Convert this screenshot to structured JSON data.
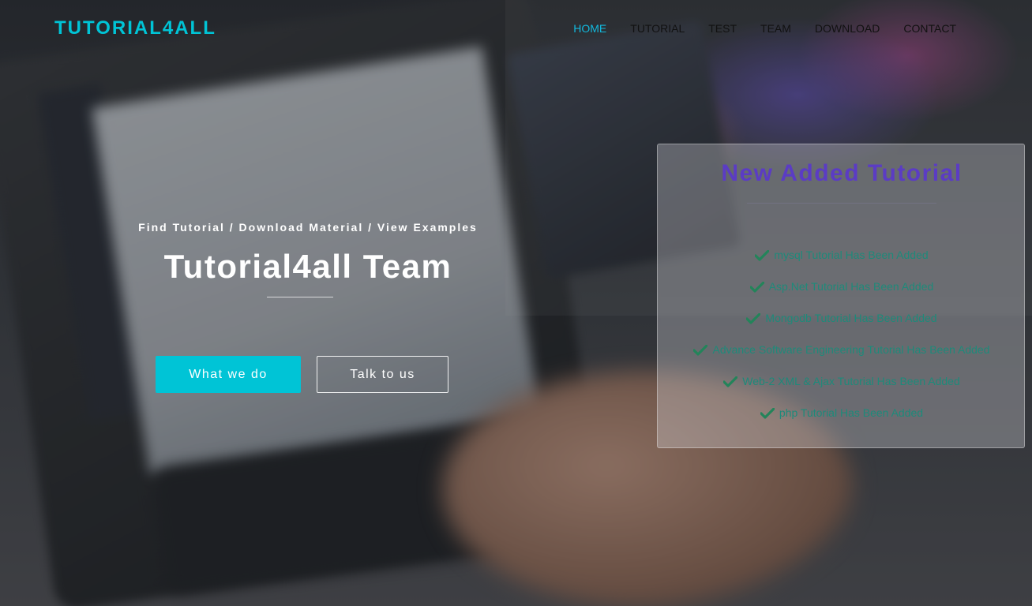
{
  "nav": {
    "brand": "TUTORIAL4ALL",
    "items": [
      {
        "label": "HOME",
        "active": true
      },
      {
        "label": "TUTORIAL",
        "active": false
      },
      {
        "label": "TEST",
        "active": false
      },
      {
        "label": "TEAM",
        "active": false
      },
      {
        "label": "DOWNLOAD",
        "active": false
      },
      {
        "label": "CONTACT",
        "active": false
      }
    ]
  },
  "hero": {
    "subtitle": "Find Tutorial / Download Material / View Examples",
    "title": "Tutorial4all Team",
    "primary_button": "What we do",
    "secondary_button": "Talk to us"
  },
  "card": {
    "title": "New Added Tutorial",
    "items": [
      "mysql Tutorial Has Been Added",
      "Asp.Net Tutorial Has Been Added",
      "Mongodb Tutorial Has Been Added",
      "Advance Software Engineering Tutorial Has Been Added",
      "Web-2 XML & Ajax Tutorial Has Been Added",
      "php Tutorial Has Been Added"
    ],
    "item_icon": "check-icon"
  },
  "colors": {
    "accent": "#00c4d6",
    "active_nav": "#12b9de",
    "card_title": "#5b3cc4",
    "card_item": "#1e8a7a",
    "check": "#23845a"
  }
}
